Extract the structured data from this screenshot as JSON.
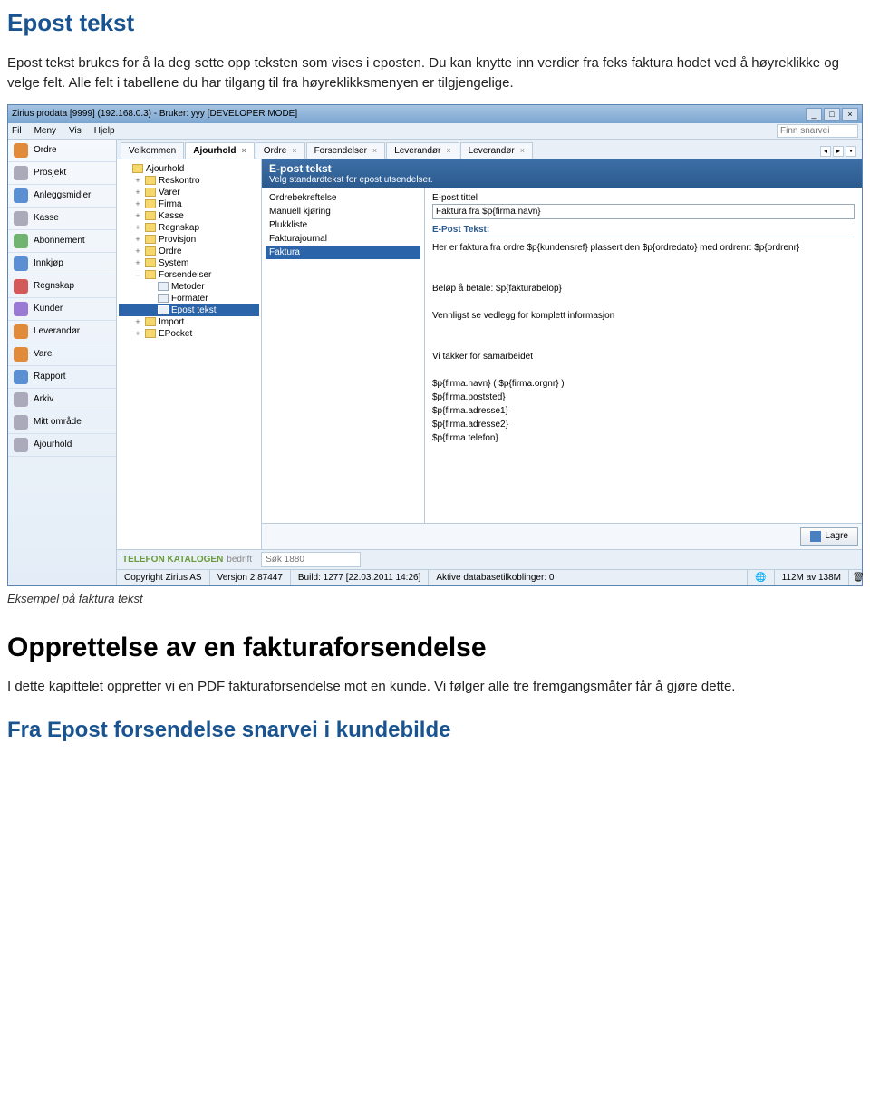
{
  "doc": {
    "title": "Epost tekst",
    "intro": "Epost tekst brukes for å la deg sette opp teksten som vises i eposten. Du kan knytte inn verdier fra feks faktura hodet ved å høyreklikke og velge felt. Alle felt i tabellene du har tilgang til fra høyreklikksmenyen er tilgjengelige.",
    "caption": "Eksempel på faktura tekst",
    "h1": "Opprettelse av en fakturaforsendelse",
    "p1": "I dette kapittelet oppretter vi en PDF fakturaforsendelse mot en kunde. Vi følger alle tre fremgangsmåter får å gjøre dette.",
    "h2": "Fra Epost forsendelse snarvei i kundebilde"
  },
  "titlebar": "Zirius prodata [9999] (192.168.0.3)  - Bruker: yyy [DEVELOPER MODE]",
  "menu": {
    "items": [
      "Fil",
      "Meny",
      "Vis",
      "Hjelp"
    ],
    "search_placeholder": "Finn snarvei"
  },
  "sidebar": [
    {
      "label": "Ordre",
      "c": "orange"
    },
    {
      "label": "Prosjekt",
      "c": "gray"
    },
    {
      "label": "Anleggsmidler",
      "c": "blue"
    },
    {
      "label": "Kasse",
      "c": "gray"
    },
    {
      "label": "Abonnement",
      "c": "green"
    },
    {
      "label": "Innkjøp",
      "c": "blue"
    },
    {
      "label": "Regnskap",
      "c": "red"
    },
    {
      "label": "Kunder",
      "c": "purple"
    },
    {
      "label": "Leverandør",
      "c": "orange"
    },
    {
      "label": "Vare",
      "c": "orange"
    },
    {
      "label": "Rapport",
      "c": "blue"
    },
    {
      "label": "Arkiv",
      "c": "gray"
    },
    {
      "label": "Mitt område",
      "c": "gray"
    },
    {
      "label": "Ajourhold",
      "c": "gray"
    }
  ],
  "tabs": [
    {
      "label": "Velkommen",
      "active": false,
      "close": false
    },
    {
      "label": "Ajourhold",
      "active": true,
      "close": true
    },
    {
      "label": "Ordre",
      "active": false,
      "close": true
    },
    {
      "label": "Forsendelser",
      "active": false,
      "close": true
    },
    {
      "label": "Leverandør",
      "active": false,
      "close": true
    },
    {
      "label": "Leverandør",
      "active": false,
      "close": true
    }
  ],
  "tree": [
    {
      "exp": "",
      "label": "Ajourhold",
      "type": "f",
      "ind": 0
    },
    {
      "exp": "+",
      "label": "Reskontro",
      "type": "f",
      "ind": 1
    },
    {
      "exp": "+",
      "label": "Varer",
      "type": "f",
      "ind": 1
    },
    {
      "exp": "+",
      "label": "Firma",
      "type": "f",
      "ind": 1
    },
    {
      "exp": "+",
      "label": "Kasse",
      "type": "f",
      "ind": 1
    },
    {
      "exp": "+",
      "label": "Regnskap",
      "type": "f",
      "ind": 1
    },
    {
      "exp": "+",
      "label": "Provisjon",
      "type": "f",
      "ind": 1
    },
    {
      "exp": "+",
      "label": "Ordre",
      "type": "f",
      "ind": 1
    },
    {
      "exp": "+",
      "label": "System",
      "type": "f",
      "ind": 1
    },
    {
      "exp": "–",
      "label": "Forsendelser",
      "type": "f",
      "ind": 1
    },
    {
      "exp": "",
      "label": "Metoder",
      "type": "d",
      "ind": 2
    },
    {
      "exp": "",
      "label": "Formater",
      "type": "d",
      "ind": 2
    },
    {
      "exp": "",
      "label": "Epost tekst",
      "type": "d",
      "ind": 2,
      "sel": true
    },
    {
      "exp": "+",
      "label": "Import",
      "type": "f",
      "ind": 1
    },
    {
      "exp": "+",
      "label": "EPocket",
      "type": "f",
      "ind": 1
    }
  ],
  "detail": {
    "header_title": "E-post tekst",
    "header_sub": "Velg standardtekst for epost utsendelser.",
    "list": [
      "Ordrebekreftelse",
      "Manuell kjøring",
      "Plukkliste",
      "Fakturajournal",
      "Faktura"
    ],
    "list_selected": "Faktura",
    "field_label": "E-post tittel",
    "field_value": "Faktura fra $p{firma.navn}",
    "section_title": "E-Post Tekst:",
    "body": "Her er faktura fra ordre $p{kundensref} plassert den $p{ordredato} med ordrenr: $p{ordrenr}\n\n\nBeløp å betale: $p{fakturabelop}\n\nVennligst se vedlegg for komplett informasjon\n\n\nVi takker for samarbeidet\n\n$p{firma.navn} ( $p{firma.orgnr} )\n$p{firma.poststed}\n$p{firma.adresse1}\n$p{firma.adresse2}\n$p{firma.telefon}",
    "save_btn": "Lagre"
  },
  "bottom": {
    "brand1": "TELEFON KATALOGEN",
    "brand2": "bedrift",
    "search_placeholder": "Søk 1880"
  },
  "status": {
    "copyright": "Copyright Zirius AS",
    "version": "Versjon 2.87447",
    "build": "Build: 1277 [22.03.2011 14:26]",
    "db": "Aktive databasetilkoblinger: 0",
    "mem": "112M av 138M"
  }
}
